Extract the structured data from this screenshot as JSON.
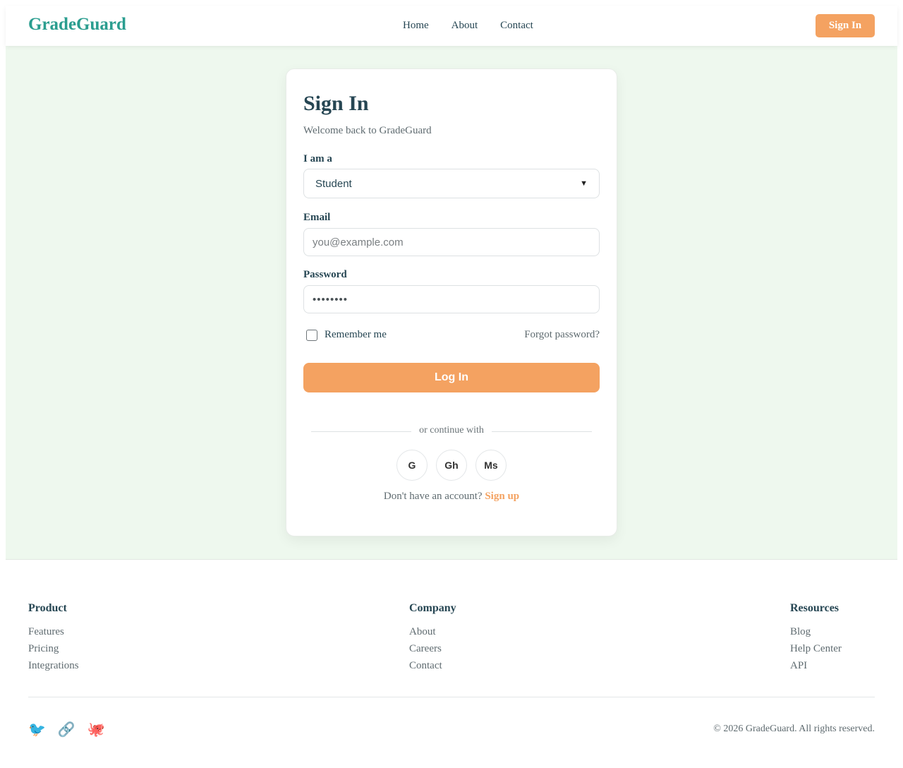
{
  "header": {
    "logo": "GradeGuard",
    "nav": [
      "Home",
      "About",
      "Contact"
    ],
    "signin_label": "Sign In"
  },
  "card": {
    "title": "Sign In",
    "subtitle": "Welcome back to GradeGuard",
    "role_label": "I am a",
    "role_value": "Student",
    "email_label": "Email",
    "email_placeholder": "you@example.com",
    "password_label": "Password",
    "password_value": "••••••••",
    "remember_label": "Remember me",
    "forgot_label": "Forgot password?",
    "login_label": "Log In",
    "divider_text": "or continue with",
    "social": [
      "G",
      "Gh",
      "Ms"
    ],
    "signup_prompt": "Don't have an account?",
    "signup_link": "Sign up"
  },
  "footer": {
    "product": {
      "title": "Product",
      "links": [
        "Features",
        "Pricing",
        "Integrations"
      ]
    },
    "company": {
      "title": "Company",
      "links": [
        "About",
        "Careers",
        "Contact"
      ]
    },
    "resources": {
      "title": "Resources",
      "links": [
        "Blog",
        "Help Center",
        "API"
      ]
    },
    "social_icons": [
      "🐦",
      "🔗",
      "🐙"
    ],
    "copyright": "© 2026 GradeGuard. All rights reserved."
  },
  "colors": {
    "brand": "#2a9d8f",
    "accent": "#f4a261",
    "text": "#264653",
    "background": "#eef8ee"
  },
  "icons": [
    "bird-icon",
    "link-icon",
    "octopus-icon",
    "chevron-down-icon"
  ]
}
